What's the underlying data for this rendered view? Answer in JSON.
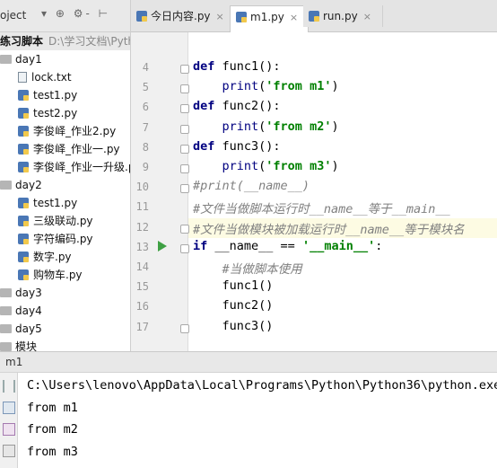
{
  "project": {
    "header_label": "oject",
    "toolbar_glyphs": "▾ ⊕ ⚙- ⊢"
  },
  "tree": {
    "root": {
      "name": "练习脚本",
      "path": "D:\\学习文档\\Pytho"
    },
    "items": [
      {
        "label": "day1",
        "kind": "folder",
        "level": 0
      },
      {
        "label": "lock.txt",
        "kind": "file",
        "level": 1
      },
      {
        "label": "test1.py",
        "kind": "py",
        "level": 1
      },
      {
        "label": "test2.py",
        "kind": "py",
        "level": 1
      },
      {
        "label": "李俊峄_作业2.py",
        "kind": "py",
        "level": 1
      },
      {
        "label": "李俊峄_作业一.py",
        "kind": "py",
        "level": 1
      },
      {
        "label": "李俊峄_作业一升级.p",
        "kind": "py",
        "level": 1
      },
      {
        "label": "day2",
        "kind": "folder",
        "level": 0
      },
      {
        "label": "test1.py",
        "kind": "py",
        "level": 1
      },
      {
        "label": "三级联动.py",
        "kind": "py",
        "level": 1
      },
      {
        "label": "字符编码.py",
        "kind": "py",
        "level": 1
      },
      {
        "label": "数字.py",
        "kind": "py",
        "level": 1
      },
      {
        "label": "购物车.py",
        "kind": "py",
        "level": 1
      },
      {
        "label": "day3",
        "kind": "folder",
        "level": 0
      },
      {
        "label": "day4",
        "kind": "folder",
        "level": 0
      },
      {
        "label": "day5",
        "kind": "folder",
        "level": 0
      },
      {
        "label": "模块",
        "kind": "folder",
        "level": 0
      }
    ]
  },
  "tabs": [
    {
      "label": "今日内容.py",
      "active": false
    },
    {
      "label": "m1.py",
      "active": true
    },
    {
      "label": "run.py",
      "active": false
    }
  ],
  "editor": {
    "lines": [
      {
        "n": "4",
        "tokens": [
          [
            "kw",
            "def "
          ],
          [
            "",
            "func1():"
          ]
        ]
      },
      {
        "n": "5",
        "tokens": [
          [
            "",
            "    "
          ],
          [
            "bi",
            "print"
          ],
          [
            "",
            "("
          ],
          [
            "str",
            "'from m1'"
          ],
          [
            "",
            ")"
          ]
        ]
      },
      {
        "n": "6",
        "tokens": [
          [
            "kw",
            "def "
          ],
          [
            "",
            "func2():"
          ]
        ]
      },
      {
        "n": "7",
        "tokens": [
          [
            "",
            "    "
          ],
          [
            "bi",
            "print"
          ],
          [
            "",
            "("
          ],
          [
            "str",
            "'from m2'"
          ],
          [
            "",
            ")"
          ]
        ]
      },
      {
        "n": "8",
        "tokens": [
          [
            "kw",
            "def "
          ],
          [
            "",
            "func3():"
          ]
        ]
      },
      {
        "n": "9",
        "tokens": [
          [
            "",
            "    "
          ],
          [
            "bi",
            "print"
          ],
          [
            "",
            "("
          ],
          [
            "str",
            "'from m3'"
          ],
          [
            "",
            ")"
          ]
        ]
      },
      {
        "n": "10",
        "tokens": [
          [
            "cm",
            "#print(__name__)"
          ]
        ]
      },
      {
        "n": "11",
        "tokens": [
          [
            "cm",
            "#文件当做脚本运行时__name__等于__main__"
          ]
        ]
      },
      {
        "n": "12",
        "tokens": [
          [
            "cm",
            "#文件当做模块被加载运行时__name__等于模块名"
          ]
        ]
      },
      {
        "n": "13",
        "tokens": [
          [
            "kw",
            "if "
          ],
          [
            "",
            "__name__ == "
          ],
          [
            "str",
            "'__main__'"
          ],
          [
            "",
            ":"
          ]
        ]
      },
      {
        "n": "14",
        "tokens": [
          [
            "",
            "    "
          ],
          [
            "cm",
            "#当做脚本使用"
          ]
        ]
      },
      {
        "n": "15",
        "tokens": [
          [
            "",
            "    func1()"
          ]
        ]
      },
      {
        "n": "16",
        "tokens": [
          [
            "",
            "    func2()"
          ]
        ]
      },
      {
        "n": "17",
        "tokens": [
          [
            "",
            "    func3()"
          ]
        ]
      }
    ]
  },
  "run": {
    "title": "m1",
    "output": [
      "C:\\Users\\lenovo\\AppData\\Local\\Programs\\Python\\Python36\\python.exe C:",
      "from m1",
      "from m2",
      "from m3"
    ]
  }
}
